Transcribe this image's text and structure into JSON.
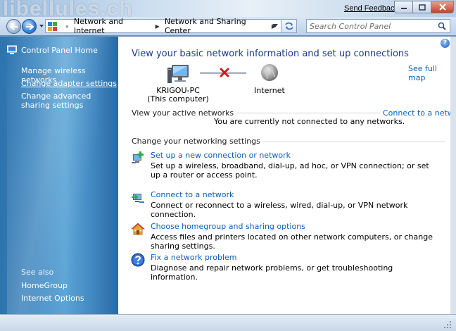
{
  "window": {
    "brand_text": "libellules.ch",
    "send_feedback": "Send Feedback"
  },
  "address": {
    "segments": [
      "Network and Internet",
      "Network and Sharing Center"
    ],
    "search_placeholder": "Search Control Panel"
  },
  "sidebar": {
    "home": "Control Panel Home",
    "links": [
      {
        "label": "Manage wireless networks"
      },
      {
        "label": "Change adapter settings"
      },
      {
        "label": "Change advanced sharing settings"
      }
    ],
    "see_also_title": "See also",
    "see_also": [
      {
        "label": "HomeGroup"
      },
      {
        "label": "Internet Options"
      }
    ]
  },
  "main": {
    "heading": "View your basic network information and set up connections",
    "see_full_map": "See full map",
    "map": {
      "computer_name": "KRIGOU-PC",
      "computer_sub": "(This computer)",
      "internet": "Internet"
    },
    "active_networks": {
      "title": "View your active networks",
      "connect_link": "Connect to a network",
      "status": "You are currently not connected to any networks."
    },
    "settings": {
      "title": "Change your networking settings",
      "tasks": [
        {
          "link": "Set up a new connection or network",
          "desc": "Set up a wireless, broadband, dial-up, ad hoc, or VPN connection; or set up a router or access point.",
          "icon": "new-connection-icon"
        },
        {
          "link": "Connect to a network",
          "desc": "Connect or reconnect to a wireless, wired, dial-up, or VPN network connection.",
          "icon": "connect-network-icon"
        },
        {
          "link": "Choose homegroup and sharing options",
          "desc": "Access files and printers located on other network computers, or change sharing settings.",
          "icon": "homegroup-icon"
        },
        {
          "link": "Fix a network problem",
          "desc": "Diagnose and repair network problems, or get troubleshooting information.",
          "icon": "troubleshoot-icon"
        }
      ]
    }
  },
  "colors": {
    "link": "#0b5fb9",
    "heading": "#1a3a8c",
    "sidebar": "#3d86c0"
  }
}
